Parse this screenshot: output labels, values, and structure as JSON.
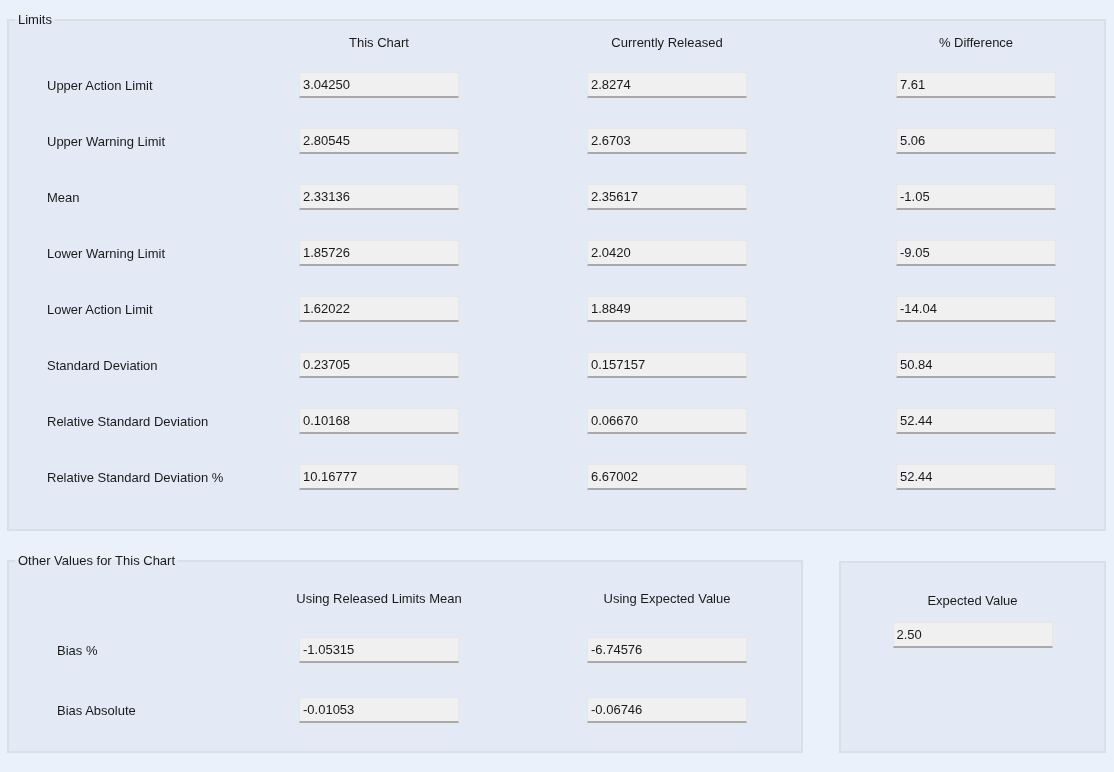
{
  "limits": {
    "title": "Limits",
    "columns": [
      "This Chart",
      "Currently Released",
      "% Difference"
    ],
    "rows": [
      {
        "label": "Upper Action Limit",
        "values": [
          "3.04250",
          "2.8274",
          "7.61"
        ]
      },
      {
        "label": "Upper Warning Limit",
        "values": [
          "2.80545",
          "2.6703",
          "5.06"
        ]
      },
      {
        "label": "Mean",
        "values": [
          "2.33136",
          "2.35617",
          "-1.05"
        ]
      },
      {
        "label": "Lower Warning Limit",
        "values": [
          "1.85726",
          "2.0420",
          "-9.05"
        ]
      },
      {
        "label": "Lower Action Limit",
        "values": [
          "1.62022",
          "1.8849",
          "-14.04"
        ]
      },
      {
        "label": "Standard Deviation",
        "values": [
          "0.23705",
          "0.157157",
          "50.84"
        ]
      },
      {
        "label": "Relative Standard Deviation",
        "values": [
          "0.10168",
          "0.06670",
          "52.44"
        ]
      },
      {
        "label": "Relative Standard Deviation %",
        "values": [
          "10.16777",
          "6.67002",
          "52.44"
        ]
      }
    ]
  },
  "other_values": {
    "title": "Other Values for This Chart",
    "columns": [
      "Using Released Limits Mean",
      "Using Expected Value"
    ],
    "rows": [
      {
        "label": "Bias %",
        "values": [
          "-1.05315",
          "-6.74576"
        ]
      },
      {
        "label": "Bias Absolute",
        "values": [
          "-0.01053",
          "-0.06746"
        ]
      }
    ]
  },
  "expected": {
    "heading": "Expected Value",
    "value": "2.50"
  }
}
